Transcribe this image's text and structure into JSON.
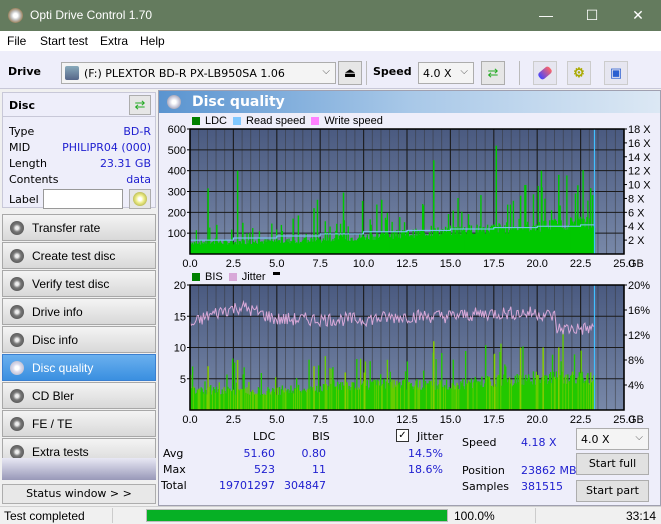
{
  "window": {
    "title": "Opti Drive Control 1.70",
    "minimize": "—",
    "maximize": "☐",
    "close": "✕"
  },
  "menu": [
    "File",
    "Start test",
    "Extra",
    "Help"
  ],
  "toolbar": {
    "drive_label": "Drive",
    "drive_value": "(F:)  PLEXTOR BD-R  PX-LB950SA 1.06",
    "speed_label": "Speed",
    "speed_value": "4.0 X"
  },
  "disc": {
    "header": "Disc",
    "fields": [
      {
        "label": "Type",
        "value": "BD-R"
      },
      {
        "label": "MID",
        "value": "PHILIPR04 (000)"
      },
      {
        "label": "Length",
        "value": "23.31 GB"
      },
      {
        "label": "Contents",
        "value": "data"
      }
    ],
    "label_field": "Label",
    "label_value": ""
  },
  "nav": [
    {
      "label": "Transfer rate",
      "active": false
    },
    {
      "label": "Create test disc",
      "active": false
    },
    {
      "label": "Verify test disc",
      "active": false
    },
    {
      "label": "Drive info",
      "active": false
    },
    {
      "label": "Disc info",
      "active": false
    },
    {
      "label": "Disc quality",
      "active": true
    },
    {
      "label": "CD Bler",
      "active": false
    },
    {
      "label": "FE / TE",
      "active": false
    },
    {
      "label": "Extra tests",
      "active": false
    }
  ],
  "status_window_label": "Status window > >",
  "panel_title": "Disc quality",
  "chart_data": [
    {
      "type": "bar",
      "title": "LDC",
      "legend": [
        {
          "name": "LDC",
          "color": "#008000"
        },
        {
          "name": "Read speed",
          "color": "#80c8ff"
        },
        {
          "name": "Write speed",
          "color": "#ff80ff"
        }
      ],
      "xlabel": "GB",
      "xlim": [
        0,
        25
      ],
      "x_ticks": [
        "0.0",
        "2.5",
        "5.0",
        "7.5",
        "10.0",
        "12.5",
        "15.0",
        "17.5",
        "20.0",
        "22.5",
        "25.0"
      ],
      "ylim": [
        0,
        600
      ],
      "y_ticks": [
        "100",
        "200",
        "300",
        "400",
        "500",
        "600"
      ],
      "y2lim": [
        0,
        18
      ],
      "y2_ticks": [
        "2 X",
        "4 X",
        "6 X",
        "8 X",
        "10 X",
        "12 X",
        "14 X",
        "16 X",
        "18 X"
      ],
      "series": [
        {
          "name": "LDC baseline",
          "x": [
            0,
            2.5,
            5,
            7.5,
            10,
            12.5,
            15,
            17.5,
            20,
            22.5,
            23.3
          ],
          "values": [
            55,
            55,
            60,
            65,
            80,
            95,
            110,
            120,
            130,
            150,
            145
          ]
        },
        {
          "name": "LDC peaks",
          "x": [
            1.0,
            1.5,
            2.7,
            3.0,
            5.9,
            6.2,
            7.1,
            7.3,
            8.8,
            9.9,
            11.0,
            14.0,
            17.6,
            19.0,
            20.2,
            21.2,
            22.3
          ],
          "values": [
            315,
            140,
            400,
            150,
            170,
            185,
            220,
            260,
            295,
            255,
            260,
            450,
            520,
            280,
            400,
            380,
            330
          ]
        },
        {
          "name": "Read speed",
          "x": [
            0,
            2.5,
            5,
            7.5,
            10,
            12.5,
            15,
            17.5,
            20,
            22.5,
            23.3
          ],
          "values": [
            2.0,
            2.3,
            2.6,
            2.9,
            3.2,
            3.4,
            3.6,
            3.8,
            4.0,
            4.2,
            4.3
          ]
        }
      ],
      "end_marker_x": 23.3
    },
    {
      "type": "bar",
      "title": "BIS",
      "legend": [
        {
          "name": "BIS",
          "color": "#008000"
        },
        {
          "name": "Jitter",
          "color": "#d8a8d8"
        }
      ],
      "xlabel": "GB",
      "xlim": [
        0,
        25
      ],
      "x_ticks": [
        "0.0",
        "2.5",
        "5.0",
        "7.5",
        "10.0",
        "12.5",
        "15.0",
        "17.5",
        "20.0",
        "22.5",
        "25.0"
      ],
      "ylim": [
        0,
        20
      ],
      "y_ticks": [
        "5",
        "10",
        "15",
        "20"
      ],
      "y2lim": [
        0,
        20
      ],
      "y2_ticks": [
        "4%",
        "8%",
        "12%",
        "16%",
        "20%"
      ],
      "series": [
        {
          "name": "BIS baseline",
          "x": [
            0,
            5,
            10,
            15,
            20,
            23.3
          ],
          "values": [
            3,
            3,
            4,
            4,
            5,
            5
          ]
        },
        {
          "name": "BIS peaks",
          "x": [
            1.0,
            2.7,
            7.1,
            8.9,
            10.0,
            14.0,
            17.5,
            19.0,
            20.3,
            21.2
          ],
          "values": [
            7,
            8,
            7,
            6,
            6,
            11,
            9,
            10,
            10,
            10
          ]
        },
        {
          "name": "Jitter",
          "x": [
            0,
            1,
            2,
            3,
            4,
            5,
            7.5,
            10,
            12.5,
            15,
            17.5,
            20,
            21,
            21.1,
            23.3
          ],
          "values": [
            13.5,
            15,
            16,
            16.5,
            15.5,
            14.5,
            14.5,
            14.5,
            15,
            15,
            15.5,
            15.5,
            15,
            13,
            13
          ]
        }
      ],
      "end_marker_x": 23.3
    }
  ],
  "stats": {
    "col_ldc": "LDC",
    "col_bis": "BIS",
    "jitter_label": "Jitter",
    "jitter_checked": true,
    "rows": [
      {
        "label": "Avg",
        "ldc": "51.60",
        "bis": "0.80",
        "jitter": "14.5%"
      },
      {
        "label": "Max",
        "ldc": "523",
        "bis": "11",
        "jitter": "18.6%"
      },
      {
        "label": "Total",
        "ldc": "19701297",
        "bis": "304847",
        "jitter": ""
      }
    ],
    "speed_label": "Speed",
    "speed_value": "4.18 X",
    "position_label": "Position",
    "position_value": "23862 MB",
    "samples_label": "Samples",
    "samples_value": "381515",
    "speed_select": "4.0 X",
    "start_full": "Start full",
    "start_part": "Start part"
  },
  "statusbar": {
    "text": "Test completed",
    "progress_percent": 100.0,
    "progress_label": "100.0%",
    "time": "33:14"
  },
  "colors": {
    "titlebar": "#647b5e",
    "plot_bg_top": "#4a5a80",
    "plot_bg_bottom": "#7888a8",
    "ldc": "#00c800",
    "read": "#80c8ff",
    "jitter": "#d8a8d8",
    "progress": "#06b025",
    "accent": "#3a8fe0"
  }
}
